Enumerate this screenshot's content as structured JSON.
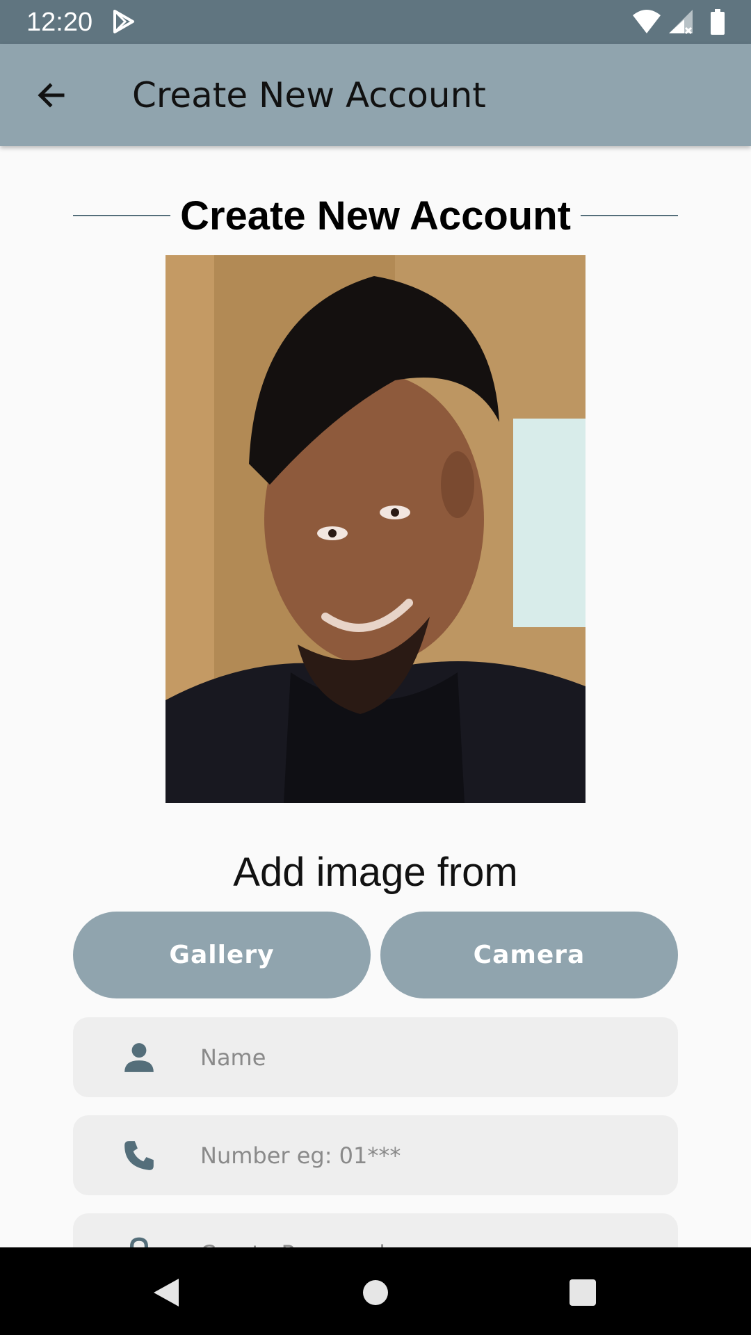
{
  "status_bar": {
    "time": "12:20",
    "icons": [
      "play-store-icon",
      "wifi-icon",
      "signal-icon",
      "battery-icon"
    ],
    "background": "#607580"
  },
  "app_bar": {
    "title": "Create New Account",
    "back_icon": "arrow-back-icon",
    "background": "#90a4ae"
  },
  "form": {
    "heading": "Create New Account",
    "photo": "profile-photo",
    "add_image_label": "Add image from",
    "gallery_label": "Gallery",
    "camera_label": "Camera",
    "name_placeholder": "Name",
    "number_placeholder": "Number eg: 01***",
    "password_placeholder": "Create Password",
    "accent": "#90a4ae",
    "field_background": "#eeeeee",
    "icon_color": "#546e7a"
  },
  "nav_bar": {
    "icons": [
      "nav-back-icon",
      "nav-home-icon",
      "nav-recents-icon"
    ]
  }
}
